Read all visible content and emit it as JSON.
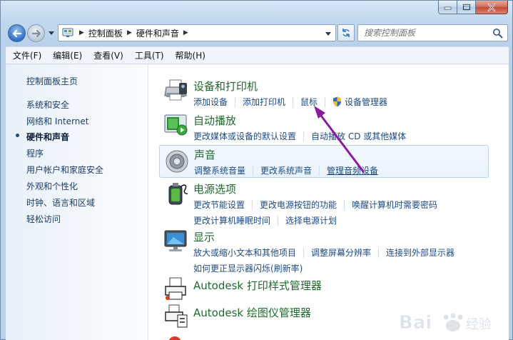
{
  "window": {
    "caption_buttons": [
      "minimize-icon",
      "maximize-icon",
      "close-icon"
    ]
  },
  "address_bar": {
    "crumbs": [
      "控制面板",
      "硬件和声音"
    ],
    "search_placeholder": "搜索控制面板"
  },
  "menubar": {
    "items": [
      "文件(F)",
      "编辑(E)",
      "查看(V)",
      "工具(T)",
      "帮助(H)"
    ]
  },
  "left_pane": {
    "home": "控制面板主页",
    "items": [
      {
        "label": "系统和安全",
        "active": false
      },
      {
        "label": "网络和 Internet",
        "active": false
      },
      {
        "label": "硬件和声音",
        "active": true
      },
      {
        "label": "程序",
        "active": false
      },
      {
        "label": "用户帐户和家庭安全",
        "active": false
      },
      {
        "label": "外观和个性化",
        "active": false
      },
      {
        "label": "时钟、语言和区域",
        "active": false
      },
      {
        "label": "轻松访问",
        "active": false
      }
    ]
  },
  "categories": [
    {
      "title": "设备和打印机",
      "icon": "printer-icon",
      "links": [
        "添加设备",
        "添加打印机",
        "鼠标",
        "设备管理器"
      ],
      "links2": []
    },
    {
      "title": "自动播放",
      "icon": "autoplay-icon",
      "links": [
        "更改媒体或设备的默认设置",
        "自动播放 CD 或其他媒体"
      ],
      "links2": []
    },
    {
      "title": "声音",
      "icon": "speaker-icon",
      "links": [
        "调整系统音量",
        "更改系统声音",
        "管理音频设备"
      ],
      "links2": []
    },
    {
      "title": "电源选项",
      "icon": "battery-icon",
      "links": [
        "更改节能设置",
        "更改电源按钮的功能",
        "唤醒计算机时需要密码"
      ],
      "links2": [
        "更改计算机睡眠时间",
        "选择电源计划"
      ]
    },
    {
      "title": "显示",
      "icon": "monitor-icon",
      "links": [
        "放大或缩小文本和其他项目",
        "调整屏幕分辨率",
        "连接到外部显示器"
      ],
      "links2": [
        "如何更正显示器闪烁(刷新率)"
      ]
    },
    {
      "title": "Autodesk 打印样式管理器",
      "icon": "print-style-icon",
      "links": [],
      "links2": []
    },
    {
      "title": "Autodesk 绘图仪管理器",
      "icon": "plotter-icon",
      "links": [],
      "links2": []
    }
  ],
  "colors": {
    "category_title": "#1d6b2c",
    "task_link": "#1e4a86",
    "annotation_arrow": "#8b1a9e"
  },
  "watermark": {
    "text": "Bai",
    "cn": "经验"
  }
}
